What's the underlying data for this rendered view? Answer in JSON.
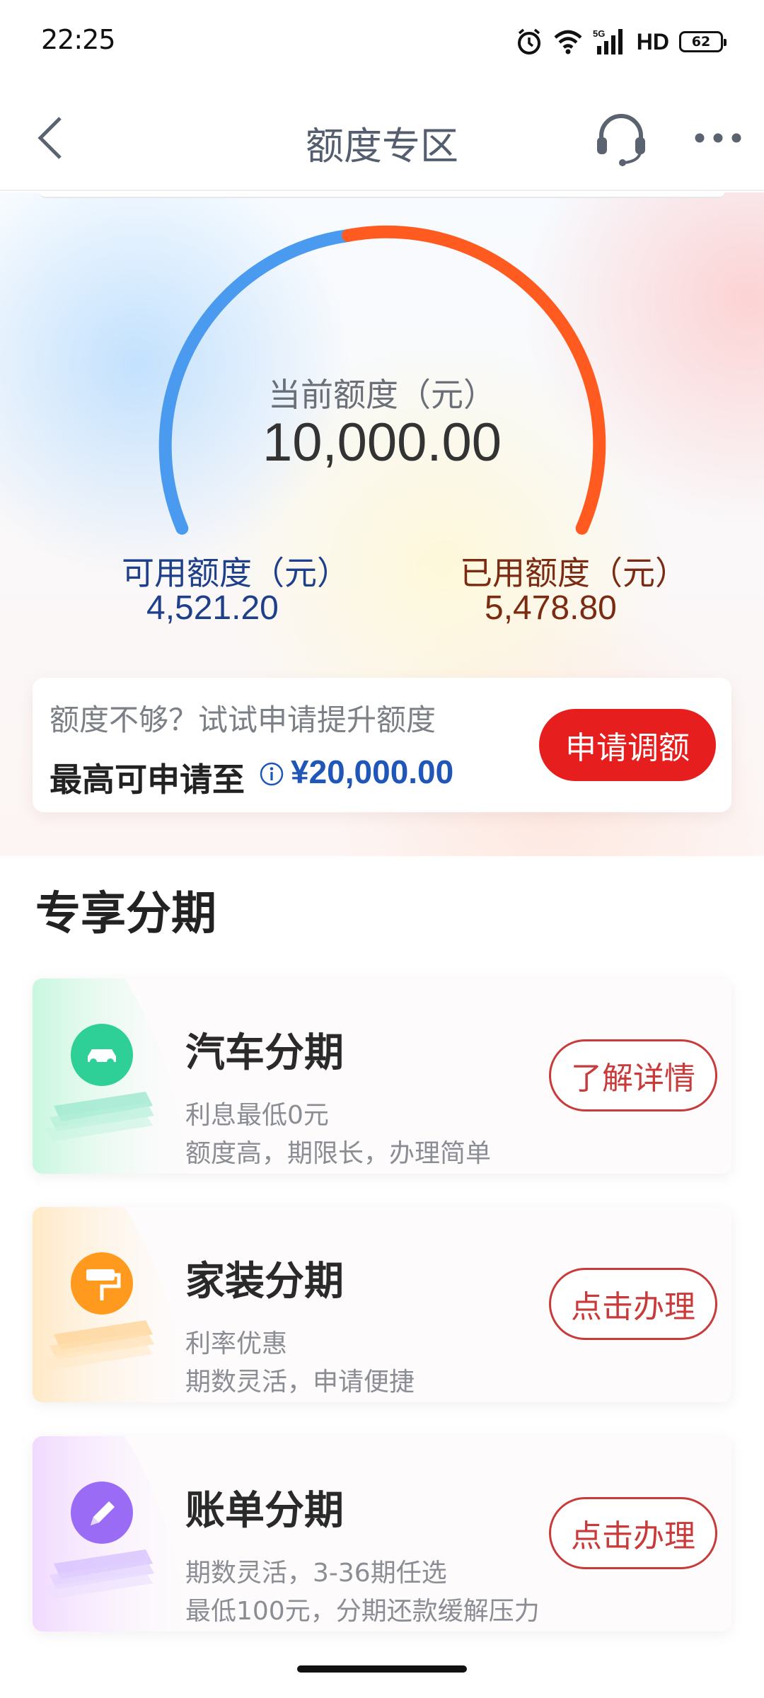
{
  "status_bar": {
    "time": "22:25",
    "hd": "HD",
    "battery": "62",
    "network": "5G"
  },
  "nav": {
    "title": "额度专区"
  },
  "quota": {
    "current_label": "当前额度（元）",
    "current_value": "10,000.00",
    "available_label": "可用额度（元）",
    "available_value": "4,521.20",
    "used_label": "已用额度（元）",
    "used_value": "5,478.80",
    "available_color": "#4a9af0",
    "used_color": "#ff5a1f"
  },
  "raise": {
    "hint": "额度不够？试试申请提升额度",
    "max_label": "最高可申请至",
    "max_amount": "¥20,000.00",
    "button": "申请调额"
  },
  "section": {
    "title": "专享分期"
  },
  "plans": [
    {
      "title": "汽车分期",
      "line1": "利息最低0元",
      "line2": "额度高，期限长，办理简单",
      "button": "了解详情",
      "icon": "car-icon",
      "color": "#2fcf98"
    },
    {
      "title": "家装分期",
      "line1": "利率优惠",
      "line2": "期数灵活，申请便捷",
      "button": "点击办理",
      "icon": "paint-roller-icon",
      "color": "#ff9a1e"
    },
    {
      "title": "账单分期",
      "line1": "期数灵活，3-36期任选",
      "line2": "最低100元，分期还款缓解压力",
      "button": "点击办理",
      "icon": "pencil-icon",
      "color": "#9a6cf5"
    }
  ]
}
